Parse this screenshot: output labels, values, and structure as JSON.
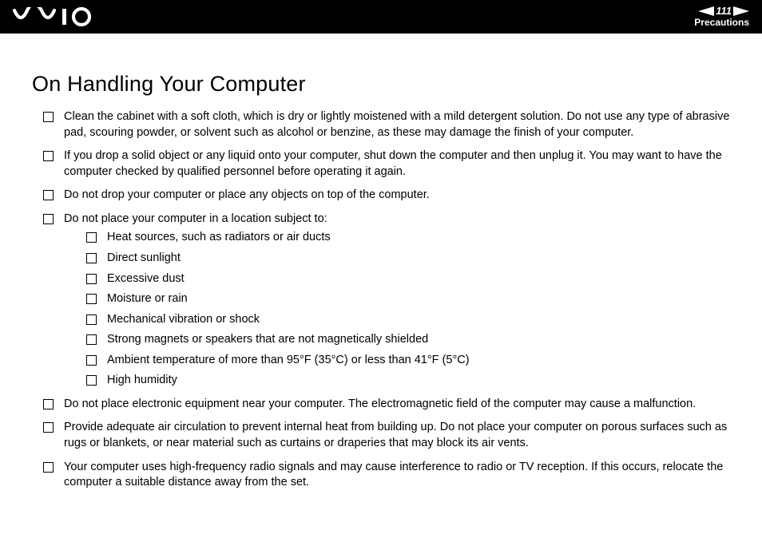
{
  "header": {
    "page_number": "111",
    "section": "Precautions"
  },
  "title": "On Handling Your Computer",
  "items": [
    {
      "text": "Clean the cabinet with a soft cloth, which is dry or lightly moistened with a mild detergent solution. Do not use any type of abrasive pad, scouring powder, or solvent such as alcohol or benzine, as these may damage the finish of your computer."
    },
    {
      "text": "If you drop a solid object or any liquid onto your computer, shut down the computer and then unplug it. You may want to have the computer checked by qualified personnel before operating it again."
    },
    {
      "text": "Do not drop your computer or place any objects on top of the computer."
    },
    {
      "text": "Do not place your computer in a location subject to:",
      "sub": [
        "Heat sources, such as radiators or air ducts",
        "Direct sunlight",
        "Excessive dust",
        "Moisture or rain",
        "Mechanical vibration or shock",
        "Strong magnets or speakers that are not magnetically shielded",
        "Ambient temperature of more than 95°F (35°C) or less than 41°F (5°C)",
        "High humidity"
      ]
    },
    {
      "text": "Do not place electronic equipment near your computer. The electromagnetic field of the computer may cause a malfunction."
    },
    {
      "text": "Provide adequate air circulation to prevent internal heat from building up. Do not place your computer on porous surfaces such as rugs or blankets, or near material such as curtains or draperies that may block its air vents."
    },
    {
      "text": "Your computer uses high-frequency radio signals and may cause interference to radio or TV reception. If this occurs, relocate the computer a suitable distance away from the set."
    }
  ]
}
